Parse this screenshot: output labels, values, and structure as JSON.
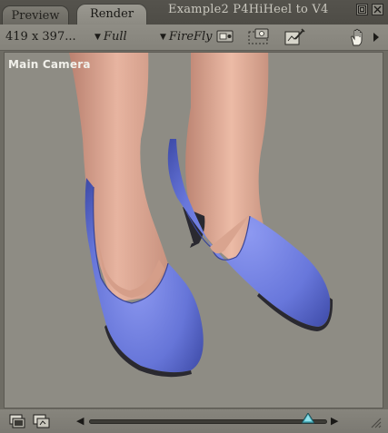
{
  "tabs": [
    {
      "label": "Preview",
      "active": false
    },
    {
      "label": "Render",
      "active": true
    }
  ],
  "window": {
    "title": "Example2 P4HiHeel to V4"
  },
  "toolbar": {
    "render_size": "419 x 397...",
    "dimensions_dropdown": "Full",
    "renderer_dropdown": "FireFly",
    "dropdown_arrow": "▼"
  },
  "viewport": {
    "camera_label": "Main Camera"
  },
  "timeline": {
    "left_arrow": "◀",
    "right_arrow": "▶",
    "position": 0.92
  },
  "colors": {
    "viewport_bg": "#8e8c84",
    "shoe": "#6675d8",
    "skin": "#e2ac97",
    "knob": "#4fb3c0"
  }
}
